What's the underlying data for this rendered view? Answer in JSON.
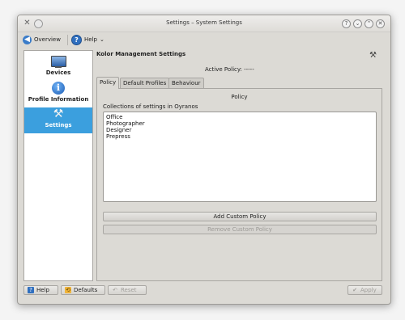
{
  "window": {
    "title": "Settings – System Settings"
  },
  "toolbar": {
    "overview_label": "Overview",
    "help_label": "Help"
  },
  "sidebar": {
    "items": [
      {
        "label": "Devices",
        "icon": "monitor-icon"
      },
      {
        "label": "Profile Information",
        "icon": "info-icon"
      },
      {
        "label": "Settings",
        "icon": "tools-icon",
        "active": true
      }
    ]
  },
  "main": {
    "title": "Kolor Management Settings",
    "active_policy": "Active Policy: -----",
    "tabs": [
      {
        "label": "Policy",
        "active": true
      },
      {
        "label": "Default Profiles"
      },
      {
        "label": "Behaviour"
      }
    ],
    "group_title": "Policy",
    "collections_label": "Collections of settings in Oyranos",
    "policies": [
      "Office",
      "Photographer",
      "Designer",
      "Prepress"
    ],
    "add_button": "Add Custom Policy",
    "remove_button": "Remove Custom Policy"
  },
  "bottom": {
    "help": "Help",
    "defaults": "Defaults",
    "reset": "Reset",
    "apply": "Apply"
  },
  "colors": {
    "selection": "#3b9fde",
    "window_bg": "#dcdad5"
  }
}
